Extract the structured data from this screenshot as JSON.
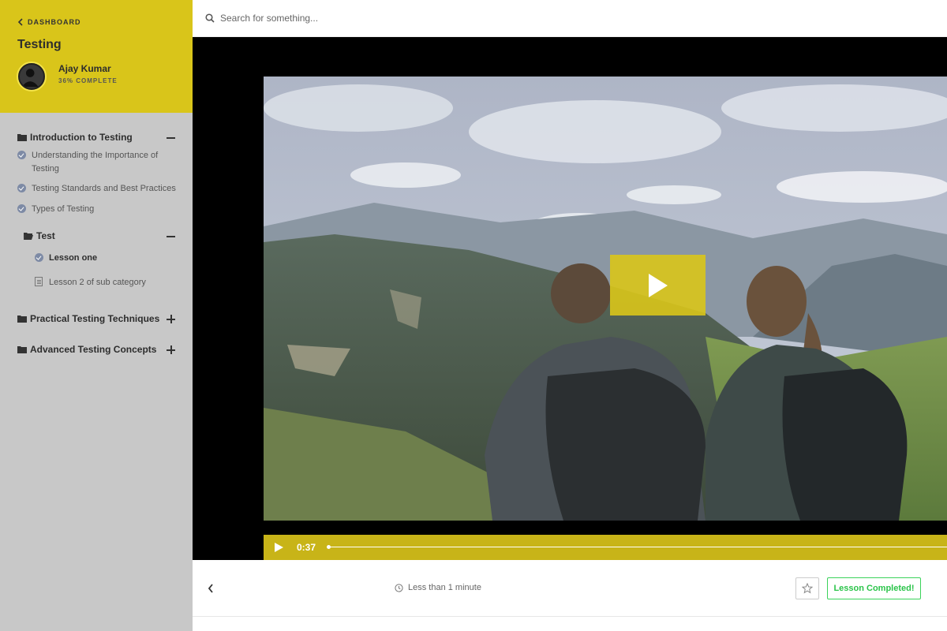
{
  "sidebar": {
    "back_label": "DASHBOARD",
    "course_title": "Testing",
    "user": {
      "name": "Ajay Kumar",
      "progress_label": "36% COMPLETE",
      "progress_percent": 36
    },
    "sections": [
      {
        "title": "Introduction to Testing",
        "expanded": true,
        "lessons": [
          {
            "title_line1": "Understanding the Importance of",
            "title_line2": "Testing",
            "status": "completed"
          },
          {
            "title": "Testing Standards and Best Practices",
            "status": "completed"
          },
          {
            "title": "Types of Testing",
            "status": "completed"
          }
        ],
        "subsections": [
          {
            "title": "Test",
            "expanded": true,
            "lessons": [
              {
                "title": "Lesson one",
                "status": "completed",
                "active": true
              },
              {
                "title": "Lesson 2 of sub category",
                "status": "document"
              }
            ]
          }
        ]
      },
      {
        "title": "Practical Testing Techniques",
        "expanded": false
      },
      {
        "title": "Advanced Testing Concepts",
        "expanded": false
      }
    ]
  },
  "search": {
    "placeholder": "Search for something...",
    "value": ""
  },
  "video": {
    "current_time": "0:37",
    "progress_fraction": 0.0
  },
  "footer": {
    "duration_label": "Less than 1 minute",
    "complete_label": "Lesson Completed!"
  },
  "colors": {
    "accent": "#d9c51a",
    "sidebar_bg": "#c8c8c8",
    "complete_green": "#2bc44a"
  },
  "icons": [
    "chevron-left-icon",
    "search-icon",
    "folder-icon",
    "folder-open-icon",
    "check-circle-icon",
    "document-icon",
    "play-icon",
    "clock-icon",
    "star-icon"
  ]
}
